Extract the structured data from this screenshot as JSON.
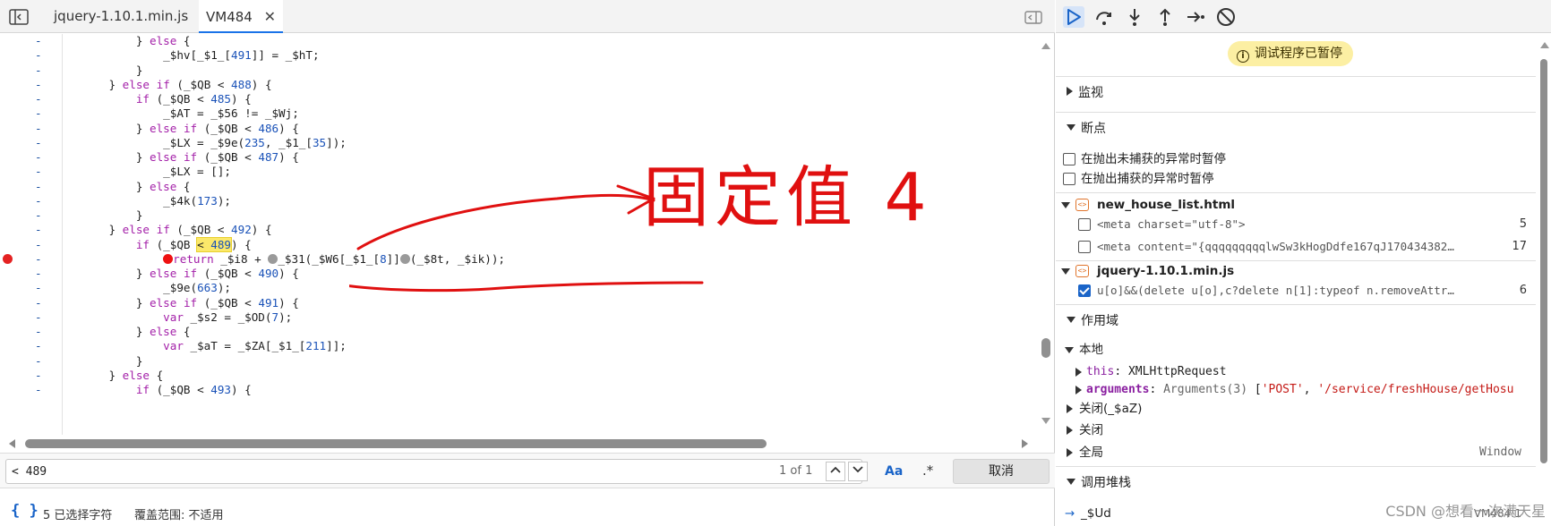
{
  "tabs": {
    "items": [
      {
        "label": "jquery-1.10.1.min.js"
      },
      {
        "label": "VM484"
      }
    ],
    "close_glyph": "✕"
  },
  "code_lines": [
    "          } else {",
    "              _$hv[_$1_[491]] = _$hT;",
    "          }",
    "      } else if (_$QB < 488) {",
    "          if (_$QB < 485) {",
    "              _$AT = _$56 != _$Wj;",
    "          } else if (_$QB < 486) {",
    "              _$LX = _$9e(235, _$1_[35]);",
    "          } else if (_$QB < 487) {",
    "              _$LX = [];",
    "          } else {",
    "              _$4k(173);",
    "          }",
    "      } else if (_$QB < 492) {",
    "          if (_$QB < 489) {",
    "              return _$i8 + _$31(_$W6[_$1_[8]](_$8t, _$ik));",
    "          } else if (_$QB < 490) {",
    "              _$9e(663);",
    "          } else if (_$QB < 491) {",
    "              var _$s2 = _$OD(7);",
    "          } else {",
    "              var _$aT = _$ZA[_$1_[211]];",
    "          }",
    "      } else {",
    "          if (_$QB < 493) {"
  ],
  "gutter_marker": "-",
  "breakpoint_line_index": 15,
  "search": {
    "query": "< 489",
    "count": "1 of 1",
    "up": "︿",
    "down": "﹀",
    "match_case": "Aa",
    "regex": ".*",
    "cancel": "取消"
  },
  "status": {
    "braces": "{ }",
    "selection": "5 已选择字符",
    "coverage": "覆盖范围: 不适用"
  },
  "annotation": {
    "text": "固定值 4",
    "color": "#e01010"
  },
  "debugger": {
    "paused": "调试程序已暂停",
    "sections": {
      "watch": "监视",
      "breakpoints": "断点",
      "scope": "作用域",
      "callstack": "调用堆栈"
    },
    "exceptions": {
      "uncaught": "在抛出未捕获的异常时暂停",
      "caught": "在抛出捕获的异常时暂停"
    },
    "bp_files": [
      {
        "name": "new_house_list.html",
        "entries": [
          {
            "code": "<meta charset=\"utf-8\">",
            "line": "5",
            "checked": false
          },
          {
            "code": "<meta content=\"{qqqqqqqqqlwSw3kHogDdfe167qJ170434382…",
            "line": "17",
            "checked": false
          }
        ]
      },
      {
        "name": "jquery-1.10.1.min.js",
        "entries": [
          {
            "code": "u[o]&&(delete u[o],c?delete n[1]:typeof n.removeAttr…",
            "line": "6",
            "checked": true
          }
        ]
      }
    ],
    "scope": {
      "local": "本地",
      "this_key": "this",
      "this_val": "XMLHttpRequest",
      "args_key": "arguments",
      "args_type": "Arguments(3)",
      "args_s1": "'POST'",
      "args_s2": "'/service/freshHouse/getHosu",
      "closure1": "关闭(_$aZ)",
      "closure2": "关闭",
      "global": "全局",
      "global_val": "Window"
    },
    "callstack": {
      "frame": "_$Ud",
      "frame_loc": "VM484:1"
    }
  },
  "watermark": "CSDN @想看一次满天星",
  "colors": {
    "accent": "#1a73e8",
    "breakpoint": "#e42222",
    "paused_bg": "#fcefa3"
  }
}
